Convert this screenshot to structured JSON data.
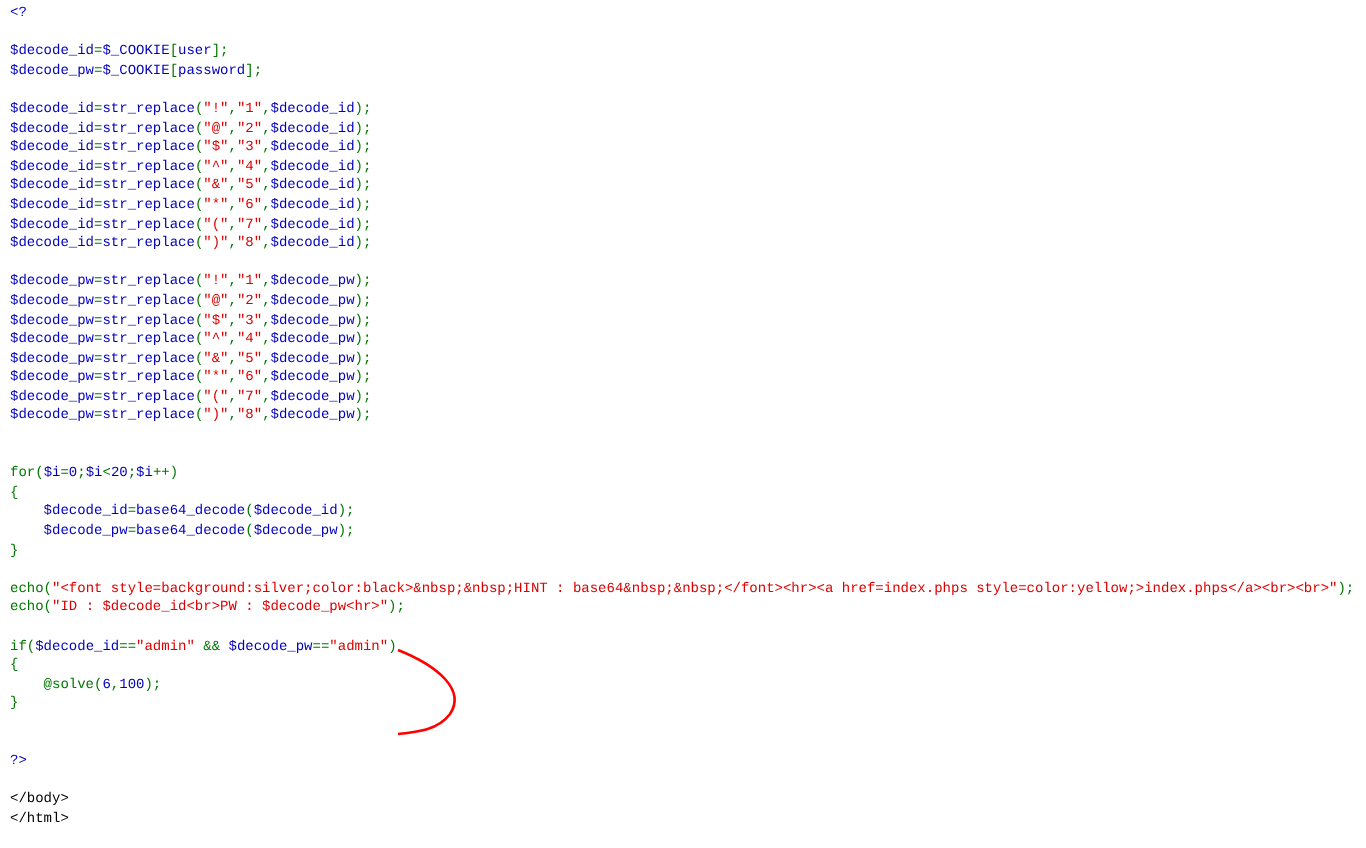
{
  "code_lines": [
    {
      "kind": "code",
      "tokens": [
        {
          "text": "<?",
          "kind": "default"
        }
      ]
    },
    {
      "kind": "blank"
    },
    {
      "kind": "code",
      "tokens": [
        {
          "text": "$decode_id",
          "kind": "default"
        },
        {
          "text": "=",
          "kind": "keyword"
        },
        {
          "text": "$_COOKIE",
          "kind": "default"
        },
        {
          "text": "[",
          "kind": "keyword"
        },
        {
          "text": "user",
          "kind": "default"
        },
        {
          "text": "];",
          "kind": "keyword"
        }
      ]
    },
    {
      "kind": "code",
      "tokens": [
        {
          "text": "$decode_pw",
          "kind": "default"
        },
        {
          "text": "=",
          "kind": "keyword"
        },
        {
          "text": "$_COOKIE",
          "kind": "default"
        },
        {
          "text": "[",
          "kind": "keyword"
        },
        {
          "text": "password",
          "kind": "default"
        },
        {
          "text": "];",
          "kind": "keyword"
        }
      ]
    },
    {
      "kind": "blank"
    },
    {
      "kind": "code",
      "tokens": [
        {
          "text": "$decode_id",
          "kind": "default"
        },
        {
          "text": "=",
          "kind": "keyword"
        },
        {
          "text": "str_replace",
          "kind": "default"
        },
        {
          "text": "(",
          "kind": "keyword"
        },
        {
          "text": "\"!\"",
          "kind": "string"
        },
        {
          "text": ",",
          "kind": "keyword"
        },
        {
          "text": "\"1\"",
          "kind": "string"
        },
        {
          "text": ",",
          "kind": "keyword"
        },
        {
          "text": "$decode_id",
          "kind": "default"
        },
        {
          "text": ");",
          "kind": "keyword"
        }
      ]
    },
    {
      "kind": "code",
      "tokens": [
        {
          "text": "$decode_id",
          "kind": "default"
        },
        {
          "text": "=",
          "kind": "keyword"
        },
        {
          "text": "str_replace",
          "kind": "default"
        },
        {
          "text": "(",
          "kind": "keyword"
        },
        {
          "text": "\"@\"",
          "kind": "string"
        },
        {
          "text": ",",
          "kind": "keyword"
        },
        {
          "text": "\"2\"",
          "kind": "string"
        },
        {
          "text": ",",
          "kind": "keyword"
        },
        {
          "text": "$decode_id",
          "kind": "default"
        },
        {
          "text": ");",
          "kind": "keyword"
        }
      ]
    },
    {
      "kind": "code",
      "tokens": [
        {
          "text": "$decode_id",
          "kind": "default"
        },
        {
          "text": "=",
          "kind": "keyword"
        },
        {
          "text": "str_replace",
          "kind": "default"
        },
        {
          "text": "(",
          "kind": "keyword"
        },
        {
          "text": "\"$\"",
          "kind": "string"
        },
        {
          "text": ",",
          "kind": "keyword"
        },
        {
          "text": "\"3\"",
          "kind": "string"
        },
        {
          "text": ",",
          "kind": "keyword"
        },
        {
          "text": "$decode_id",
          "kind": "default"
        },
        {
          "text": ");",
          "kind": "keyword"
        }
      ]
    },
    {
      "kind": "code",
      "tokens": [
        {
          "text": "$decode_id",
          "kind": "default"
        },
        {
          "text": "=",
          "kind": "keyword"
        },
        {
          "text": "str_replace",
          "kind": "default"
        },
        {
          "text": "(",
          "kind": "keyword"
        },
        {
          "text": "\"^\"",
          "kind": "string"
        },
        {
          "text": ",",
          "kind": "keyword"
        },
        {
          "text": "\"4\"",
          "kind": "string"
        },
        {
          "text": ",",
          "kind": "keyword"
        },
        {
          "text": "$decode_id",
          "kind": "default"
        },
        {
          "text": ");",
          "kind": "keyword"
        }
      ]
    },
    {
      "kind": "code",
      "tokens": [
        {
          "text": "$decode_id",
          "kind": "default"
        },
        {
          "text": "=",
          "kind": "keyword"
        },
        {
          "text": "str_replace",
          "kind": "default"
        },
        {
          "text": "(",
          "kind": "keyword"
        },
        {
          "text": "\"&\"",
          "kind": "string"
        },
        {
          "text": ",",
          "kind": "keyword"
        },
        {
          "text": "\"5\"",
          "kind": "string"
        },
        {
          "text": ",",
          "kind": "keyword"
        },
        {
          "text": "$decode_id",
          "kind": "default"
        },
        {
          "text": ");",
          "kind": "keyword"
        }
      ]
    },
    {
      "kind": "code",
      "tokens": [
        {
          "text": "$decode_id",
          "kind": "default"
        },
        {
          "text": "=",
          "kind": "keyword"
        },
        {
          "text": "str_replace",
          "kind": "default"
        },
        {
          "text": "(",
          "kind": "keyword"
        },
        {
          "text": "\"*\"",
          "kind": "string"
        },
        {
          "text": ",",
          "kind": "keyword"
        },
        {
          "text": "\"6\"",
          "kind": "string"
        },
        {
          "text": ",",
          "kind": "keyword"
        },
        {
          "text": "$decode_id",
          "kind": "default"
        },
        {
          "text": ");",
          "kind": "keyword"
        }
      ]
    },
    {
      "kind": "code",
      "tokens": [
        {
          "text": "$decode_id",
          "kind": "default"
        },
        {
          "text": "=",
          "kind": "keyword"
        },
        {
          "text": "str_replace",
          "kind": "default"
        },
        {
          "text": "(",
          "kind": "keyword"
        },
        {
          "text": "\"(\"",
          "kind": "string"
        },
        {
          "text": ",",
          "kind": "keyword"
        },
        {
          "text": "\"7\"",
          "kind": "string"
        },
        {
          "text": ",",
          "kind": "keyword"
        },
        {
          "text": "$decode_id",
          "kind": "default"
        },
        {
          "text": ");",
          "kind": "keyword"
        }
      ]
    },
    {
      "kind": "code",
      "tokens": [
        {
          "text": "$decode_id",
          "kind": "default"
        },
        {
          "text": "=",
          "kind": "keyword"
        },
        {
          "text": "str_replace",
          "kind": "default"
        },
        {
          "text": "(",
          "kind": "keyword"
        },
        {
          "text": "\")\"",
          "kind": "string"
        },
        {
          "text": ",",
          "kind": "keyword"
        },
        {
          "text": "\"8\"",
          "kind": "string"
        },
        {
          "text": ",",
          "kind": "keyword"
        },
        {
          "text": "$decode_id",
          "kind": "default"
        },
        {
          "text": ");",
          "kind": "keyword"
        }
      ]
    },
    {
      "kind": "blank"
    },
    {
      "kind": "code",
      "tokens": [
        {
          "text": "$decode_pw",
          "kind": "default"
        },
        {
          "text": "=",
          "kind": "keyword"
        },
        {
          "text": "str_replace",
          "kind": "default"
        },
        {
          "text": "(",
          "kind": "keyword"
        },
        {
          "text": "\"!\"",
          "kind": "string"
        },
        {
          "text": ",",
          "kind": "keyword"
        },
        {
          "text": "\"1\"",
          "kind": "string"
        },
        {
          "text": ",",
          "kind": "keyword"
        },
        {
          "text": "$decode_pw",
          "kind": "default"
        },
        {
          "text": ");",
          "kind": "keyword"
        }
      ]
    },
    {
      "kind": "code",
      "tokens": [
        {
          "text": "$decode_pw",
          "kind": "default"
        },
        {
          "text": "=",
          "kind": "keyword"
        },
        {
          "text": "str_replace",
          "kind": "default"
        },
        {
          "text": "(",
          "kind": "keyword"
        },
        {
          "text": "\"@\"",
          "kind": "string"
        },
        {
          "text": ",",
          "kind": "keyword"
        },
        {
          "text": "\"2\"",
          "kind": "string"
        },
        {
          "text": ",",
          "kind": "keyword"
        },
        {
          "text": "$decode_pw",
          "kind": "default"
        },
        {
          "text": ");",
          "kind": "keyword"
        }
      ]
    },
    {
      "kind": "code",
      "tokens": [
        {
          "text": "$decode_pw",
          "kind": "default"
        },
        {
          "text": "=",
          "kind": "keyword"
        },
        {
          "text": "str_replace",
          "kind": "default"
        },
        {
          "text": "(",
          "kind": "keyword"
        },
        {
          "text": "\"$\"",
          "kind": "string"
        },
        {
          "text": ",",
          "kind": "keyword"
        },
        {
          "text": "\"3\"",
          "kind": "string"
        },
        {
          "text": ",",
          "kind": "keyword"
        },
        {
          "text": "$decode_pw",
          "kind": "default"
        },
        {
          "text": ");",
          "kind": "keyword"
        }
      ]
    },
    {
      "kind": "code",
      "tokens": [
        {
          "text": "$decode_pw",
          "kind": "default"
        },
        {
          "text": "=",
          "kind": "keyword"
        },
        {
          "text": "str_replace",
          "kind": "default"
        },
        {
          "text": "(",
          "kind": "keyword"
        },
        {
          "text": "\"^\"",
          "kind": "string"
        },
        {
          "text": ",",
          "kind": "keyword"
        },
        {
          "text": "\"4\"",
          "kind": "string"
        },
        {
          "text": ",",
          "kind": "keyword"
        },
        {
          "text": "$decode_pw",
          "kind": "default"
        },
        {
          "text": ");",
          "kind": "keyword"
        }
      ]
    },
    {
      "kind": "code",
      "tokens": [
        {
          "text": "$decode_pw",
          "kind": "default"
        },
        {
          "text": "=",
          "kind": "keyword"
        },
        {
          "text": "str_replace",
          "kind": "default"
        },
        {
          "text": "(",
          "kind": "keyword"
        },
        {
          "text": "\"&\"",
          "kind": "string"
        },
        {
          "text": ",",
          "kind": "keyword"
        },
        {
          "text": "\"5\"",
          "kind": "string"
        },
        {
          "text": ",",
          "kind": "keyword"
        },
        {
          "text": "$decode_pw",
          "kind": "default"
        },
        {
          "text": ");",
          "kind": "keyword"
        }
      ]
    },
    {
      "kind": "code",
      "tokens": [
        {
          "text": "$decode_pw",
          "kind": "default"
        },
        {
          "text": "=",
          "kind": "keyword"
        },
        {
          "text": "str_replace",
          "kind": "default"
        },
        {
          "text": "(",
          "kind": "keyword"
        },
        {
          "text": "\"*\"",
          "kind": "string"
        },
        {
          "text": ",",
          "kind": "keyword"
        },
        {
          "text": "\"6\"",
          "kind": "string"
        },
        {
          "text": ",",
          "kind": "keyword"
        },
        {
          "text": "$decode_pw",
          "kind": "default"
        },
        {
          "text": ");",
          "kind": "keyword"
        }
      ]
    },
    {
      "kind": "code",
      "tokens": [
        {
          "text": "$decode_pw",
          "kind": "default"
        },
        {
          "text": "=",
          "kind": "keyword"
        },
        {
          "text": "str_replace",
          "kind": "default"
        },
        {
          "text": "(",
          "kind": "keyword"
        },
        {
          "text": "\"(\"",
          "kind": "string"
        },
        {
          "text": ",",
          "kind": "keyword"
        },
        {
          "text": "\"7\"",
          "kind": "string"
        },
        {
          "text": ",",
          "kind": "keyword"
        },
        {
          "text": "$decode_pw",
          "kind": "default"
        },
        {
          "text": ");",
          "kind": "keyword"
        }
      ]
    },
    {
      "kind": "code",
      "tokens": [
        {
          "text": "$decode_pw",
          "kind": "default"
        },
        {
          "text": "=",
          "kind": "keyword"
        },
        {
          "text": "str_replace",
          "kind": "default"
        },
        {
          "text": "(",
          "kind": "keyword"
        },
        {
          "text": "\")\"",
          "kind": "string"
        },
        {
          "text": ",",
          "kind": "keyword"
        },
        {
          "text": "\"8\"",
          "kind": "string"
        },
        {
          "text": ",",
          "kind": "keyword"
        },
        {
          "text": "$decode_pw",
          "kind": "default"
        },
        {
          "text": ");",
          "kind": "keyword"
        }
      ]
    },
    {
      "kind": "blank"
    },
    {
      "kind": "blank"
    },
    {
      "kind": "code",
      "tokens": [
        {
          "text": "for(",
          "kind": "keyword"
        },
        {
          "text": "$i",
          "kind": "default"
        },
        {
          "text": "=",
          "kind": "keyword"
        },
        {
          "text": "0",
          "kind": "default"
        },
        {
          "text": ";",
          "kind": "keyword"
        },
        {
          "text": "$i",
          "kind": "default"
        },
        {
          "text": "<",
          "kind": "keyword"
        },
        {
          "text": "20",
          "kind": "default"
        },
        {
          "text": ";",
          "kind": "keyword"
        },
        {
          "text": "$i",
          "kind": "default"
        },
        {
          "text": "++)",
          "kind": "keyword"
        }
      ]
    },
    {
      "kind": "code",
      "tokens": [
        {
          "text": "{",
          "kind": "keyword"
        }
      ]
    },
    {
      "kind": "code",
      "tokens": [
        {
          "text": "    $decode_id",
          "kind": "default"
        },
        {
          "text": "=",
          "kind": "keyword"
        },
        {
          "text": "base64_decode",
          "kind": "default"
        },
        {
          "text": "(",
          "kind": "keyword"
        },
        {
          "text": "$decode_id",
          "kind": "default"
        },
        {
          "text": ");",
          "kind": "keyword"
        }
      ]
    },
    {
      "kind": "code",
      "tokens": [
        {
          "text": "    $decode_pw",
          "kind": "default"
        },
        {
          "text": "=",
          "kind": "keyword"
        },
        {
          "text": "base64_decode",
          "kind": "default"
        },
        {
          "text": "(",
          "kind": "keyword"
        },
        {
          "text": "$decode_pw",
          "kind": "default"
        },
        {
          "text": ");",
          "kind": "keyword"
        }
      ]
    },
    {
      "kind": "code",
      "tokens": [
        {
          "text": "}",
          "kind": "keyword"
        }
      ]
    },
    {
      "kind": "blank"
    },
    {
      "kind": "code",
      "tokens": [
        {
          "text": "echo(",
          "kind": "keyword"
        },
        {
          "text": "\"<font style=background:silver;color:black>&nbsp;&nbsp;HINT : base64&nbsp;&nbsp;</font><hr><a href=index.phps style=color:yellow;>index.phps</a><br><br>\"",
          "kind": "string"
        },
        {
          "text": ");",
          "kind": "keyword"
        }
      ]
    },
    {
      "kind": "code",
      "tokens": [
        {
          "text": "echo(",
          "kind": "keyword"
        },
        {
          "text": "\"ID : $decode_id<br>PW : $decode_pw<hr>\"",
          "kind": "string"
        },
        {
          "text": ");",
          "kind": "keyword"
        }
      ]
    },
    {
      "kind": "blank"
    },
    {
      "kind": "code",
      "tokens": [
        {
          "text": "if(",
          "kind": "keyword"
        },
        {
          "text": "$decode_id",
          "kind": "default"
        },
        {
          "text": "==",
          "kind": "keyword"
        },
        {
          "text": "\"admin\"",
          "kind": "string"
        },
        {
          "text": " && ",
          "kind": "keyword"
        },
        {
          "text": "$decode_pw",
          "kind": "default"
        },
        {
          "text": "==",
          "kind": "keyword"
        },
        {
          "text": "\"admin\"",
          "kind": "string"
        },
        {
          "text": ")",
          "kind": "keyword"
        }
      ]
    },
    {
      "kind": "code",
      "tokens": [
        {
          "text": "{",
          "kind": "keyword"
        }
      ]
    },
    {
      "kind": "code",
      "tokens": [
        {
          "text": "    @solve(",
          "kind": "keyword"
        },
        {
          "text": "6",
          "kind": "default"
        },
        {
          "text": ",",
          "kind": "keyword"
        },
        {
          "text": "100",
          "kind": "default"
        },
        {
          "text": ");",
          "kind": "keyword"
        }
      ]
    },
    {
      "kind": "code",
      "tokens": [
        {
          "text": "}",
          "kind": "keyword"
        }
      ]
    },
    {
      "kind": "blank"
    },
    {
      "kind": "blank"
    },
    {
      "kind": "code",
      "tokens": [
        {
          "text": "?>",
          "kind": "default"
        }
      ]
    },
    {
      "kind": "blank"
    },
    {
      "kind": "code",
      "tokens": [
        {
          "text": "</body>",
          "kind": "html"
        }
      ]
    },
    {
      "kind": "code",
      "tokens": [
        {
          "text": "</html>",
          "kind": "html"
        }
      ]
    }
  ]
}
